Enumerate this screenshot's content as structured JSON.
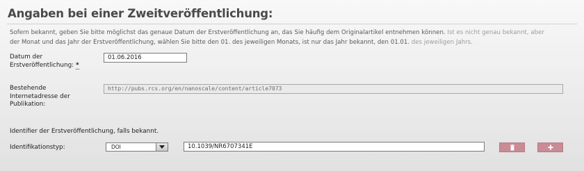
{
  "section": {
    "title": "Angaben bei einer Zweitveröffentlichung:",
    "intro_line1": "Sofern bekannt, geben Sie bitte möglichst das genaue Datum der Erstveröffentlichung an, das Sie häufig dem Originalartikel entnehmen können.",
    "intro_line1_faded": " Ist es nicht genau bekannt, aber",
    "intro_line2": "der Monat und das Jahr der Erstveröffentlichung, wählen Sie bitte den 01. des jeweiligen Monats, ist nur das Jahr bekannt, den 01.01.",
    "intro_line2_faded": " des jeweiligen Jahrs."
  },
  "date_field": {
    "label_line1": "Datum der",
    "label_line2": "Erstveröffentlichung:",
    "required_marker": "*",
    "value": "01.06.2016"
  },
  "url_field": {
    "label_line1": "Bestehende",
    "label_line2": "Internetadresse der",
    "label_line3": "Publikation:",
    "value": "http://pubs.rcs.org/en/nanoscale/content/article7073"
  },
  "identifier": {
    "hint": "Identifier der Erstveröffentlichung, falls bekannt.",
    "type_label": "Identifikationstyp:",
    "type_selected": "DOI",
    "value": "10.1039/NR6707341E"
  },
  "buttons": {
    "delete_icon": "trash-icon",
    "add_icon": "plus-icon",
    "accent_color": "#c98b96"
  }
}
